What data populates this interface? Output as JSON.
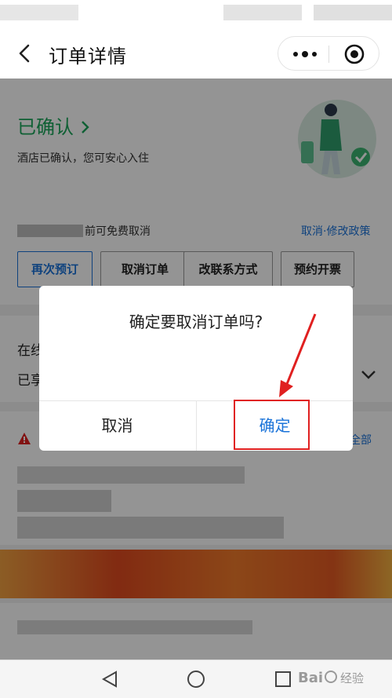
{
  "nav": {
    "title": "订单详情"
  },
  "order": {
    "status_title": "已确认 ",
    "status_desc": "酒店已确认，您可安心入住",
    "cancel_note": "前可免费取消",
    "policy_link": "取消·修改政策",
    "actions": [
      {
        "label": "再次预订"
      },
      {
        "label": "取消订单"
      },
      {
        "label": "改联系方式"
      },
      {
        "label": "预约开票"
      }
    ]
  },
  "middle": {
    "line1": "在线",
    "line2": "已享"
  },
  "notice": {
    "all_link": "全部"
  },
  "dialog": {
    "message": "确定要取消订单吗?",
    "cancel_label": "取消",
    "confirm_label": "确定"
  },
  "colors": {
    "brand_green": "#1aa55a",
    "link_blue": "#1a73d9",
    "annotation_red": "#e02020"
  },
  "icons": [
    "back-icon",
    "more-icon",
    "target-icon",
    "chevron-down-icon",
    "warning-icon",
    "back-triangle-icon",
    "home-circle-icon",
    "recent-square-icon"
  ]
}
